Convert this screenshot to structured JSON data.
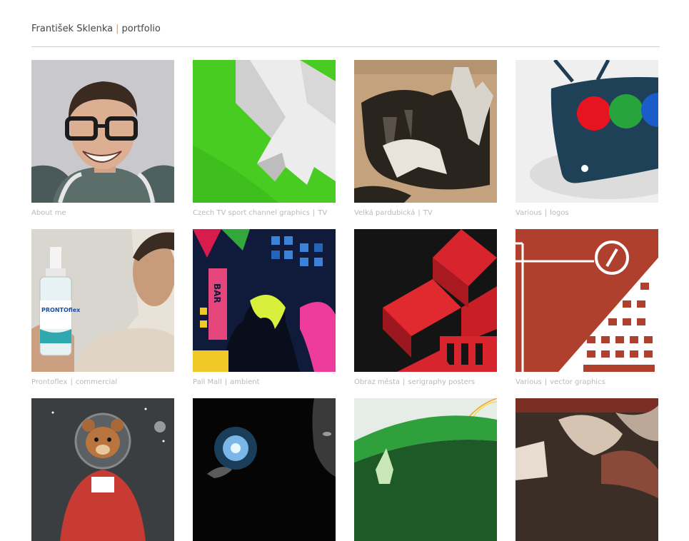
{
  "header": {
    "name": "František Sklenka",
    "separator": "|",
    "section": "portfolio"
  },
  "items": [
    {
      "title": "About me",
      "tag": ""
    },
    {
      "title": "Czech TV sport channel graphics",
      "tag": "TV"
    },
    {
      "title": "Velká pardubická",
      "tag": "TV"
    },
    {
      "title": "Various",
      "tag": "logos"
    },
    {
      "title": "Prontoflex",
      "tag": "commercial"
    },
    {
      "title": "Pall Mall",
      "tag": "ambient"
    },
    {
      "title": "Obraz města",
      "tag": "serigraphy posters"
    },
    {
      "title": "Various",
      "tag": "vector graphics"
    },
    {
      "title": "",
      "tag": ""
    },
    {
      "title": "",
      "tag": ""
    },
    {
      "title": "",
      "tag": ""
    },
    {
      "title": "",
      "tag": ""
    }
  ],
  "thumb_text": {
    "bar_sign": "BAR",
    "brand_on_bottle": "PRONTOflex"
  }
}
